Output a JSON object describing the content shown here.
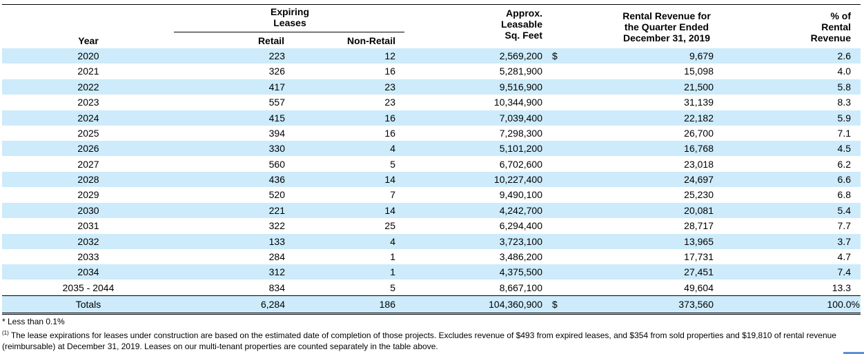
{
  "header": {
    "year": "Year",
    "expiring_leases": "Expiring\nLeases",
    "retail": "Retail",
    "non_retail": "Non-Retail",
    "sqft": "Approx.\nLeasable\nSq. Feet",
    "revenue": "Rental Revenue for\nthe Quarter Ended\nDecember 31, 2019",
    "pct": "% of\nRental\nRevenue"
  },
  "rows": [
    {
      "year": "2020",
      "retail": "223",
      "non_retail": "12",
      "sqft": "2,569,200",
      "dollar": "$",
      "revenue": "9,679",
      "pct": "2.6"
    },
    {
      "year": "2021",
      "retail": "326",
      "non_retail": "16",
      "sqft": "5,281,900",
      "dollar": "",
      "revenue": "15,098",
      "pct": "4.0"
    },
    {
      "year": "2022",
      "retail": "417",
      "non_retail": "23",
      "sqft": "9,516,900",
      "dollar": "",
      "revenue": "21,500",
      "pct": "5.8"
    },
    {
      "year": "2023",
      "retail": "557",
      "non_retail": "23",
      "sqft": "10,344,900",
      "dollar": "",
      "revenue": "31,139",
      "pct": "8.3"
    },
    {
      "year": "2024",
      "retail": "415",
      "non_retail": "16",
      "sqft": "7,039,400",
      "dollar": "",
      "revenue": "22,182",
      "pct": "5.9"
    },
    {
      "year": "2025",
      "retail": "394",
      "non_retail": "16",
      "sqft": "7,298,300",
      "dollar": "",
      "revenue": "26,700",
      "pct": "7.1"
    },
    {
      "year": "2026",
      "retail": "330",
      "non_retail": "4",
      "sqft": "5,101,200",
      "dollar": "",
      "revenue": "16,768",
      "pct": "4.5"
    },
    {
      "year": "2027",
      "retail": "560",
      "non_retail": "5",
      "sqft": "6,702,600",
      "dollar": "",
      "revenue": "23,018",
      "pct": "6.2"
    },
    {
      "year": "2028",
      "retail": "436",
      "non_retail": "14",
      "sqft": "10,227,400",
      "dollar": "",
      "revenue": "24,697",
      "pct": "6.6"
    },
    {
      "year": "2029",
      "retail": "520",
      "non_retail": "7",
      "sqft": "9,490,100",
      "dollar": "",
      "revenue": "25,230",
      "pct": "6.8"
    },
    {
      "year": "2030",
      "retail": "221",
      "non_retail": "14",
      "sqft": "4,242,700",
      "dollar": "",
      "revenue": "20,081",
      "pct": "5.4"
    },
    {
      "year": "2031",
      "retail": "322",
      "non_retail": "25",
      "sqft": "6,294,400",
      "dollar": "",
      "revenue": "28,717",
      "pct": "7.7"
    },
    {
      "year": "2032",
      "retail": "133",
      "non_retail": "4",
      "sqft": "3,723,100",
      "dollar": "",
      "revenue": "13,965",
      "pct": "3.7"
    },
    {
      "year": "2033",
      "retail": "284",
      "non_retail": "1",
      "sqft": "3,486,200",
      "dollar": "",
      "revenue": "17,731",
      "pct": "4.7"
    },
    {
      "year": "2034",
      "retail": "312",
      "non_retail": "1",
      "sqft": "4,375,500",
      "dollar": "",
      "revenue": "27,451",
      "pct": "7.4"
    },
    {
      "year": "2035 - 2044",
      "retail": "834",
      "non_retail": "5",
      "sqft": "8,667,100",
      "dollar": "",
      "revenue": "49,604",
      "pct": "13.3"
    }
  ],
  "totals": {
    "label": "Totals",
    "retail": "6,284",
    "non_retail": "186",
    "sqft": "104,360,900",
    "dollar": "$",
    "revenue": "373,560",
    "pct": "100.0%"
  },
  "footnotes": {
    "less_than": "* Less than 0.1%",
    "marker": "(1)",
    "note": "The lease expirations for leases under construction are based on the estimated date of completion of those projects. Excludes revenue of $493 from expired leases, and $354 from sold properties and $19,810 of rental revenue (reimbursable) at December 31, 2019. Leases on our multi-tenant properties are counted separately in the table above."
  }
}
